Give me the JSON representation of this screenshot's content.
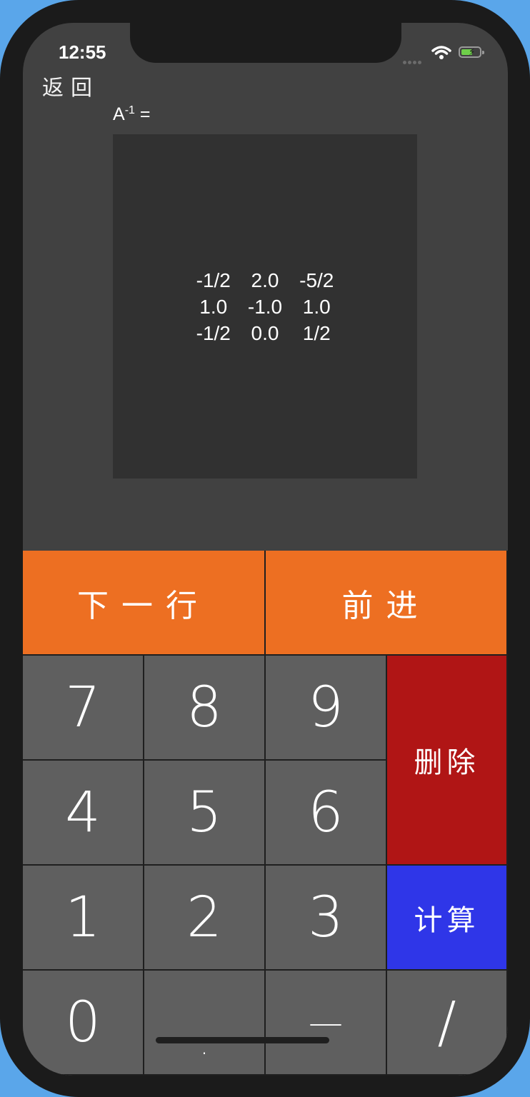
{
  "status_bar": {
    "time": "12:55"
  },
  "nav": {
    "back_label": "返回"
  },
  "matrix": {
    "label_base": "A",
    "label_exponent": "-1",
    "label_suffix": " =",
    "rows": [
      [
        "-1/2",
        "2.0",
        "-5/2"
      ],
      [
        "1.0",
        "-1.0",
        "1.0"
      ],
      [
        "-1/2",
        "0.0",
        "1/2"
      ]
    ]
  },
  "keypad": {
    "next_row": "下一行",
    "forward": "前进",
    "delete": "删除",
    "calculate": "计算",
    "digits": {
      "k7": "7",
      "k8": "8",
      "k9": "9",
      "k4": "4",
      "k5": "5",
      "k6": "6",
      "k1": "1",
      "k2": "2",
      "k3": "3",
      "k0": "0",
      "dot": ".",
      "minus": "—",
      "slash": "/"
    }
  },
  "colors": {
    "orange": "#ed6f22",
    "red": "#b01515",
    "blue": "#2f36e8",
    "key_gray": "#5f5f5f",
    "screen_bg": "#414141",
    "panel_bg": "#313131"
  },
  "icons": [
    "wifi-icon",
    "battery-charging-icon",
    "signal-icon"
  ]
}
